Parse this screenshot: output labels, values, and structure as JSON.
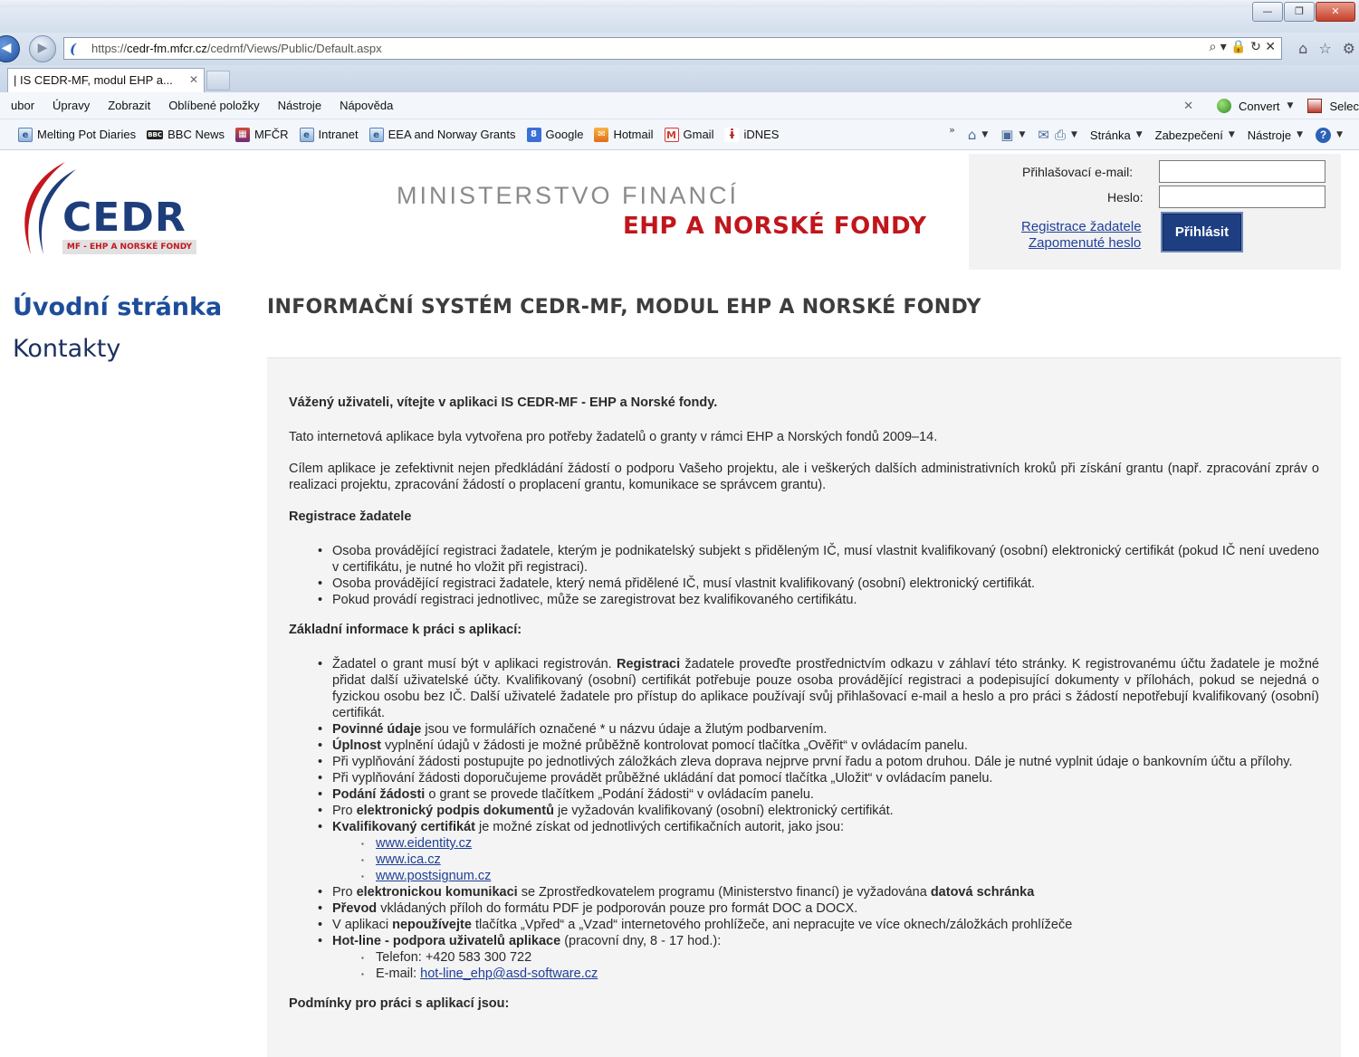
{
  "browser": {
    "window_buttons": [
      "—",
      "❐",
      "✕"
    ],
    "url_protocol": "https://",
    "url_host": "cedr-fm.mfcr.cz",
    "url_path": "/cedrnf/Views/Public/Default.aspx",
    "url_tools": "⌕ ▾ 🔒 ↻ ✕",
    "right_icons": [
      "⌂",
      "☆",
      "⚙"
    ],
    "tab_title": "| IS CEDR-MF, modul EHP a...",
    "tab_close": "✕",
    "menu": [
      "ubor",
      "Úpravy",
      "Zobrazit",
      "Oblíbené položky",
      "Nástroje",
      "Nápověda"
    ],
    "menu_close": "✕",
    "convert_label": "Convert",
    "select_label": "Selec",
    "favorites": [
      {
        "label": "Melting Pot Diaries",
        "icon": "page-icon",
        "glyph": "e"
      },
      {
        "label": "BBC News",
        "icon": "bbc-icon",
        "glyph": "BBC"
      },
      {
        "label": "MFČR",
        "icon": "mfcr-icon",
        "glyph": "▦"
      },
      {
        "label": "Intranet",
        "icon": "page-icon",
        "glyph": "e"
      },
      {
        "label": "EEA and Norway Grants",
        "icon": "page-icon",
        "glyph": "e"
      },
      {
        "label": "Google",
        "icon": "google-icon",
        "glyph": "8"
      },
      {
        "label": "Hotmail",
        "icon": "hotmail-icon",
        "glyph": "✉"
      },
      {
        "label": "Gmail",
        "icon": "gmail-icon",
        "glyph": "M"
      },
      {
        "label": "iDNES",
        "icon": "idnes-icon",
        "glyph": "ɨ"
      }
    ],
    "fav_more": "»",
    "cmd_stranka": "Stránka",
    "cmd_zabezpeceni": "Zabezpečení",
    "cmd_nastroje": "Nástroje",
    "dropdown_glyph": "▼",
    "help_glyph": "?"
  },
  "header": {
    "logo_text": "CEDR",
    "logo_tagline": "MF - EHP A NORSKÉ FONDY",
    "ministry": "MINISTERSTVO FINANCÍ",
    "subtitle": "EHP A NORSKÉ FONDY"
  },
  "login": {
    "email_label": "Přihlašovací e-mail:",
    "email_value": "",
    "password_label": "Heslo:",
    "password_value": "",
    "register_link": "Registrace žadatele",
    "forgot_link": "Zapomenuté heslo",
    "submit": "Přihlásit"
  },
  "nav": {
    "home": "Úvodní stránka",
    "contacts": "Kontakty"
  },
  "main": {
    "heading": "INFORMAČNÍ SYSTÉM CEDR-MF, MODUL EHP A NORSKÉ FONDY",
    "welcome": "Vážený uživateli, vítejte v aplikaci IS CEDR-MF - EHP a Norské fondy.",
    "intro": "Tato internetová aplikace byla vytvořena pro potřeby žadatelů o granty v rámci EHP a Norských fondů 2009–14.",
    "goal": "Cílem aplikace je zefektivnit nejen předkládání žádostí o podporu Vašeho projektu, ale i veškerých dalších administrativních kroků při získání grantu (např. zpracování zpráv o realizaci projektu, zpracování žádostí o proplacení grantu, komunikace se správcem grantu).",
    "registration_heading": "Registrace žadatele",
    "registration_items": [
      "Osoba provádějící registraci žadatele, kterým je podnikatelský subjekt s přiděleným IČ, musí vlastnit kvalifikovaný (osobní) elektronický certifikát (pokud IČ není uvedeno v certifikátu, je nutné ho vložit při registraci).",
      "Osoba provádějící registraci žadatele, který nemá přidělené IČ, musí vlastnit kvalifikovaný (osobní) elektronický certifikát.",
      "Pokud provádí registraci jednotlivec, může se zaregistrovat bez kvalifikovaného certifikátu."
    ],
    "basic_heading": "Základní informace k práci s aplikací:",
    "basic": {
      "i1_a": "Žadatel o grant musí být v aplikaci registrován. ",
      "i1_b": "Registraci",
      "i1_c": " žadatele proveďte prostřednictvím odkazu v záhlaví této stránky. K registrovanému účtu žadatele je možné přidat další uživatelské účty. Kvalifikovaný (osobní) certifikát potřebuje pouze osoba provádějící registraci a podepisující dokumenty v přílohách, pokud se nejedná o fyzickou osobu bez IČ. Další uživatelé žadatele pro přístup do aplikace používají svůj přihlašovací e-mail a heslo a pro práci s žádostí nepotřebují kvalifikovaný (osobní) certifikát.",
      "i2_a": "Povinné údaje",
      "i2_b": " jsou ve formulářích označené * u názvu údaje a žlutým podbarvením.",
      "i3_a": "Úplnost",
      "i3_b": " vyplnění údajů v žádosti je možné průběžně kontrolovat pomocí tlačítka „Ověřit“ v ovládacím panelu.",
      "i4": "Při vyplňování žádosti postupujte po jednotlivých záložkách zleva doprava nejprve první řadu a potom druhou. Dále je nutné vyplnit údaje o bankovním účtu a přílohy.",
      "i5": "Při vyplňování žádosti doporučujeme provádět průběžné ukládání dat pomocí tlačítka „Uložit“ v ovládacím panelu.",
      "i6_a": "Podání žádosti",
      "i6_b": " o grant se provede tlačítkem „Podání žádosti“ v ovládacím panelu.",
      "i7_a": "Pro ",
      "i7_b": "elektronický podpis dokumentů",
      "i7_c": " je vyžadován kvalifikovaný (osobní) elektronický certifikát.",
      "i8_a": "Kvalifikovaný certifikát",
      "i8_b": " je možné získat od jednotlivých certifikačních autorit, jako jsou:",
      "cert_links": [
        "www.eidentity.cz",
        "www.ica.cz",
        "www.postsignum.cz"
      ],
      "i9_a": "Pro ",
      "i9_b": "elektronickou komunikaci",
      "i9_c": " se Zprostředkovatelem programu (Ministerstvo financí) je vyžadována ",
      "i9_d": "datová schránka",
      "i10_a": "Převod",
      "i10_b": " vkládaných příloh do formátu PDF je podporován pouze pro formát DOC a DOCX.",
      "i11_a": "V aplikaci ",
      "i11_b": "nepoužívejte",
      "i11_c": " tlačítka „Vpřed“ a „Vzad“ internetového prohlížeče, ani nepracujte ve více oknech/záložkách prohlížeče",
      "i12_a": "Hot-line - podpora uživatelů aplikace",
      "i12_b": " (pracovní dny, 8 - 17 hod.):",
      "phone": "Telefon: +420 583 300 722",
      "email_prefix": "E-mail: ",
      "email_link": "hot-line_ehp@asd-software.cz"
    },
    "conditions_heading": "Podmínky pro práci s aplikací jsou:"
  },
  "colors": {
    "brand_blue": "#1e3e82",
    "brand_red": "#c0161c",
    "link": "#1e3f99"
  }
}
